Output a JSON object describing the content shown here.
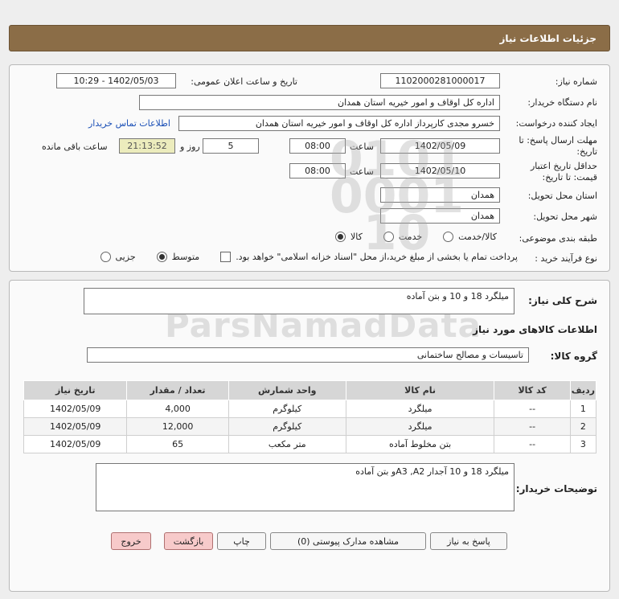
{
  "header": {
    "title": "جزئیات اطلاعات نیاز"
  },
  "form": {
    "need_number_label": "شماره نیاز:",
    "need_number": "1102000281000017",
    "announce_label": "تاریخ و ساعت اعلان عمومی:",
    "announce_value": "1402/05/03 - 10:29",
    "buyer_org_label": "نام دستگاه خریدار:",
    "buyer_org": "اداره کل اوقاف و امور خیریه استان همدان",
    "creator_label": "ایجاد کننده درخواست:",
    "creator": "خسرو مجدی کارپرداز اداره کل اوقاف و امور خیریه استان همدان",
    "contact_link": "اطلاعات تماس خریدار",
    "deadline_label_1": "مهلت ارسال پاسخ: تا",
    "deadline_label_2": "تاریخ:",
    "deadline_date": "1402/05/09",
    "time_label": "ساعت",
    "deadline_time": "08:00",
    "days_value": "5",
    "days_label": "روز و",
    "remaining_time": "21:13:52",
    "remaining_label": "ساعت باقی مانده",
    "validity_label_1": "حداقل تاریخ اعتبار",
    "validity_label_2": "قیمت: تا تاریخ:",
    "validity_date": "1402/05/10",
    "validity_time": "08:00",
    "province_label": "استان محل تحویل:",
    "province": "همدان",
    "city_label": "شهر محل تحویل:",
    "city": "همدان",
    "category_label": "طبقه بندی موضوعی:",
    "category_options": [
      "کالا",
      "خدمت",
      "کالا/خدمت"
    ],
    "category_selected": "کالا",
    "process_label": "نوع فرآیند خرید :",
    "process_options": [
      "جزیی",
      "متوسط"
    ],
    "process_selected": "متوسط",
    "payment_note": "پرداخت تمام یا بخشی از مبلغ خرید،از محل \"اسناد خزانه اسلامی\" خواهد بود."
  },
  "need": {
    "summary_label": "شرح کلی نیاز:",
    "summary": "میلگرد 18 و 10 و بتن آماده",
    "goods_info_title": "اطلاعات کالاهای مورد نیاز",
    "group_label": "گروه کالا:",
    "group": "تاسیسات و مصالح ساختمانی"
  },
  "table": {
    "headers": [
      "ردیف",
      "کد کالا",
      "نام کالا",
      "واحد شمارش",
      "تعداد / مقدار",
      "تاریخ نیاز"
    ],
    "rows": [
      [
        "1",
        "--",
        "میلگرد",
        "کیلوگرم",
        "4,000",
        "1402/05/09"
      ],
      [
        "2",
        "--",
        "میلگرد",
        "کیلوگرم",
        "12,000",
        "1402/05/09"
      ],
      [
        "3",
        "--",
        "بتن مخلوط آماده",
        "متر مکعب",
        "65",
        "1402/05/09"
      ]
    ]
  },
  "buyer_notes": {
    "label": "توضیحات خریدار:",
    "text": "میلگرد 18 و 10 آجدار A3 ,A2و بتن آماده"
  },
  "buttons": {
    "reply": "پاسخ به نیاز",
    "attachments": "مشاهده مدارک پیوستی (0)",
    "print": "چاپ",
    "back": "بازگشت",
    "exit": "خروج"
  },
  "colors": {
    "header_bg": "#8b6d47",
    "remaining_bg": "#ececbd",
    "link": "#1a4fb6",
    "exit_btn": "#f7caca"
  }
}
